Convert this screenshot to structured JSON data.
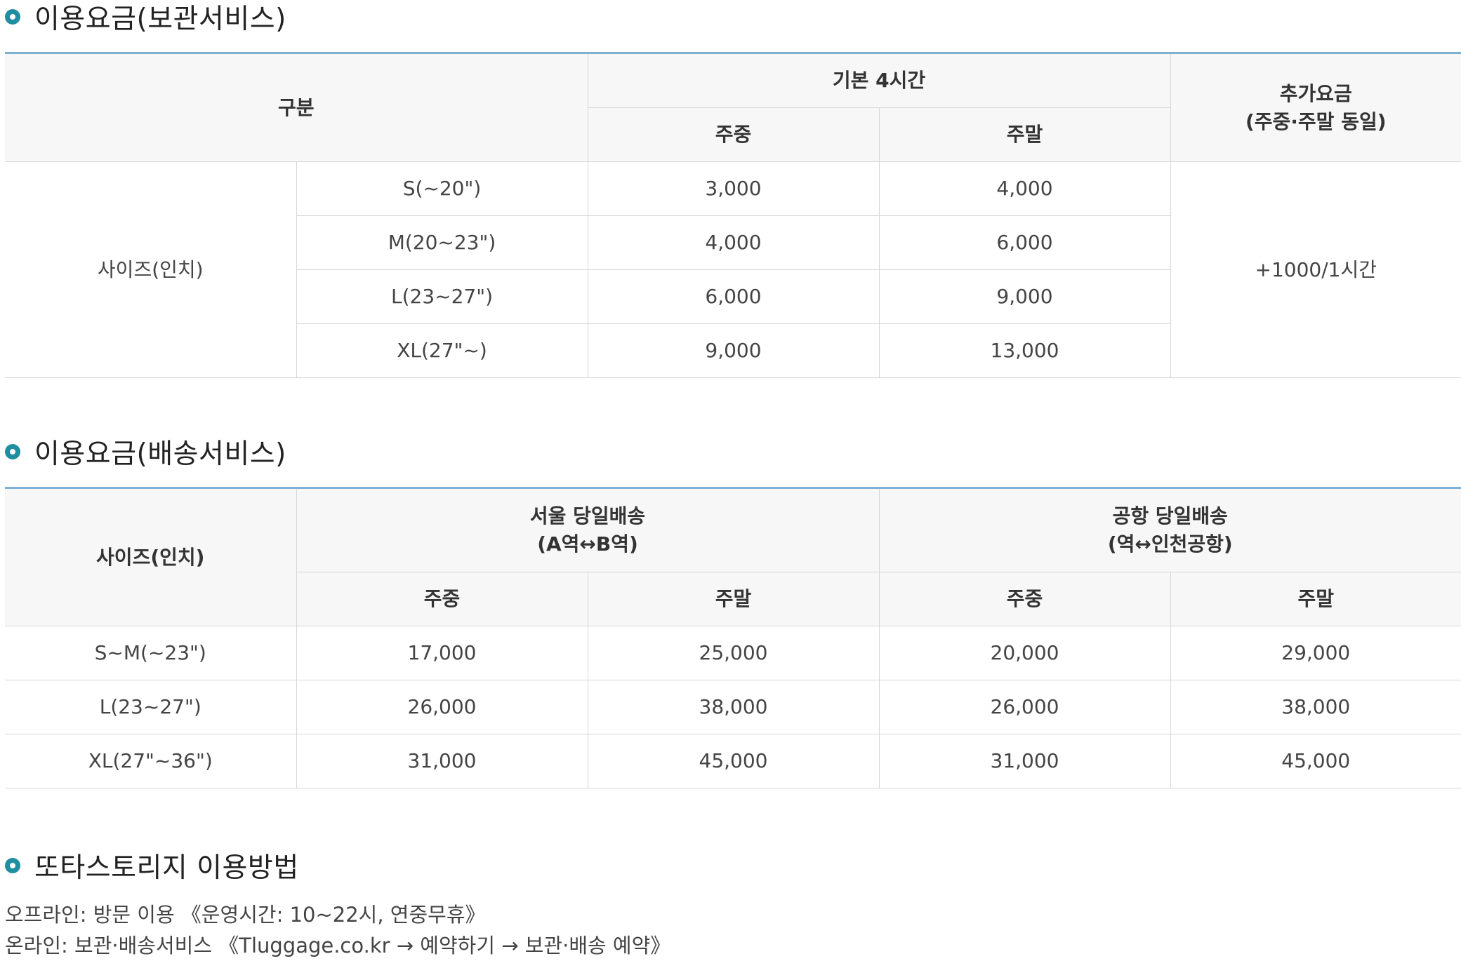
{
  "storage": {
    "title": "이용요금(보관서비스)",
    "header": {
      "category": "구분",
      "basic": "기본 4시간",
      "weekday": "주중",
      "weekend": "주말",
      "extra_line1": "추가요금",
      "extra_line2": "(주중·주말 동일)"
    },
    "size_label": "사이즈(인치)",
    "extra_value": "+1000/1시간",
    "rows": [
      {
        "size": "S(~20\")",
        "weekday": "3,000",
        "weekend": "4,000"
      },
      {
        "size": "M(20~23\")",
        "weekday": "4,000",
        "weekend": "6,000"
      },
      {
        "size": "L(23~27\")",
        "weekday": "6,000",
        "weekend": "9,000"
      },
      {
        "size": "XL(27\"~)",
        "weekday": "9,000",
        "weekend": "13,000"
      }
    ]
  },
  "delivery": {
    "title": "이용요금(배송서비스)",
    "header": {
      "size": "사이즈(인치)",
      "seoul_line1": "서울 당일배송",
      "seoul_line2": "(A역↔B역)",
      "airport_line1": "공항 당일배송",
      "airport_line2": "(역↔인천공항)",
      "weekday": "주중",
      "weekend": "주말"
    },
    "rows": [
      {
        "size": "S~M(~23\")",
        "seoul_weekday": "17,000",
        "seoul_weekend": "25,000",
        "airport_weekday": "20,000",
        "airport_weekend": "29,000"
      },
      {
        "size": "L(23~27\")",
        "seoul_weekday": "26,000",
        "seoul_weekend": "38,000",
        "airport_weekday": "26,000",
        "airport_weekend": "38,000"
      },
      {
        "size": "XL(27\"~36\")",
        "seoul_weekday": "31,000",
        "seoul_weekend": "45,000",
        "airport_weekday": "31,000",
        "airport_weekend": "45,000"
      }
    ]
  },
  "howto": {
    "title": "또타스토리지 이용방법",
    "offline": "오프라인: 방문 이용 《운영시간: 10~22시, 연중무휴》",
    "online": "온라인: 보관·배송서비스 《Tluggage.co.kr → 예약하기 → 보관·배송 예약》"
  },
  "colors": {
    "accent": "#1f8ea0",
    "table_top_border": "#7db0d4",
    "header_bg": "#f7f7f7"
  }
}
